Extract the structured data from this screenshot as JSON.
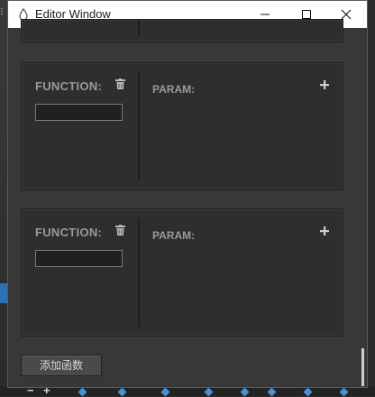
{
  "window": {
    "title": "Editor Window"
  },
  "functions": [
    {
      "label": "FUNCTION:",
      "value": "",
      "param_label": "PARAM:"
    },
    {
      "label": "FUNCTION:",
      "value": "",
      "param_label": "PARAM:"
    }
  ],
  "footer": {
    "add_button_label": "添加函数"
  },
  "icons": {
    "app": "unity-icon",
    "delete": "trash-icon",
    "add": "plus-icon",
    "minimize": "minimize-icon",
    "maximize": "maximize-icon",
    "close": "close-icon"
  },
  "colors": {
    "panel_bg": "#2e2e2e",
    "window_bg": "#383838",
    "label": "#9a9a9a",
    "titlebar": "#ffffff"
  }
}
